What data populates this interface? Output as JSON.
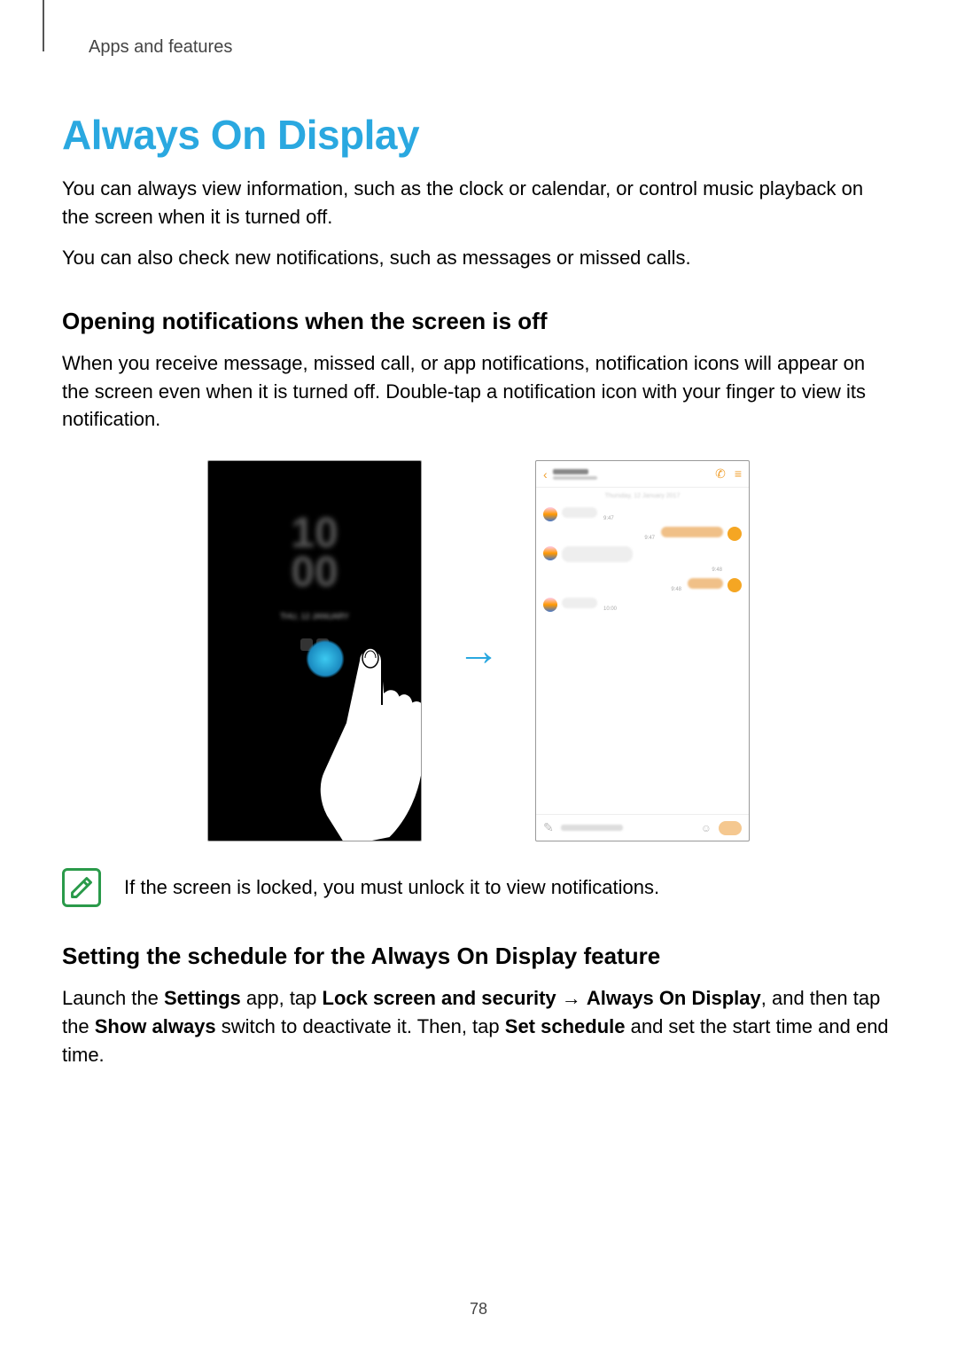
{
  "breadcrumb": "Apps and features",
  "h1": "Always On Display",
  "p1": "You can always view information, such as the clock or calendar, or control music playback on the screen when it is turned off.",
  "p2": "You can also check new notifications, such as messages or missed calls.",
  "h2a": "Opening notifications when the screen is off",
  "p3": "When you receive message, missed call, or app notifications, notification icons will appear on the screen even when it is turned off. Double-tap a notification icon with your finger to view its notification.",
  "aod": {
    "clock_top": "10",
    "clock_bottom": "00",
    "date": "THU, 12 JANUARY"
  },
  "chat": {
    "date": "Thursday, 12 January 2017",
    "times": {
      "t1": "9:47",
      "t2": "9:47",
      "t3": "9:48",
      "t4": "9:48",
      "t5": "10:00"
    }
  },
  "note": "If the screen is locked, you must unlock it to view notifications.",
  "h2b": "Setting the schedule for the Always On Display feature",
  "p4_parts": {
    "a": "Launch the ",
    "b_settings": "Settings",
    "c": " app, tap ",
    "b_lock": "Lock screen and security",
    "d": " → ",
    "b_aod": "Always On Display",
    "e": ", and then tap the ",
    "b_show": "Show always",
    "f": " switch to deactivate it. Then, tap ",
    "b_set": "Set schedule",
    "g": " and set the start time and end time."
  },
  "page_number": "78"
}
